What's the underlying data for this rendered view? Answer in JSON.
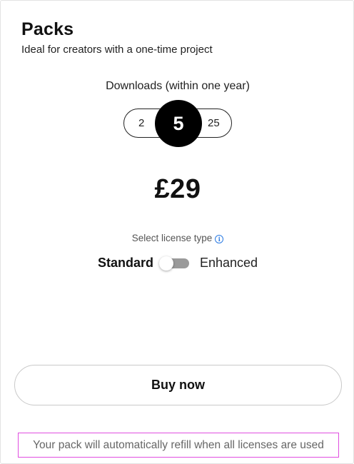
{
  "pack": {
    "title": "Packs",
    "subtitle": "Ideal for creators with a one-time project"
  },
  "downloads": {
    "label": "Downloads (within one year)",
    "options": [
      "2",
      "5",
      "25"
    ],
    "selected": "5"
  },
  "price": "£29",
  "license": {
    "label": "Select license type",
    "info_icon": "info-circle-icon",
    "options": [
      "Standard",
      "Enhanced"
    ],
    "selected": "Standard"
  },
  "actions": {
    "buy_label": "Buy now"
  },
  "footer": {
    "refill_note": "Your pack will automatically refill when all licenses are used"
  },
  "colors": {
    "accent_info": "#2b7be3",
    "selected_bg": "#000000",
    "highlight_border": "#e04ee0"
  }
}
